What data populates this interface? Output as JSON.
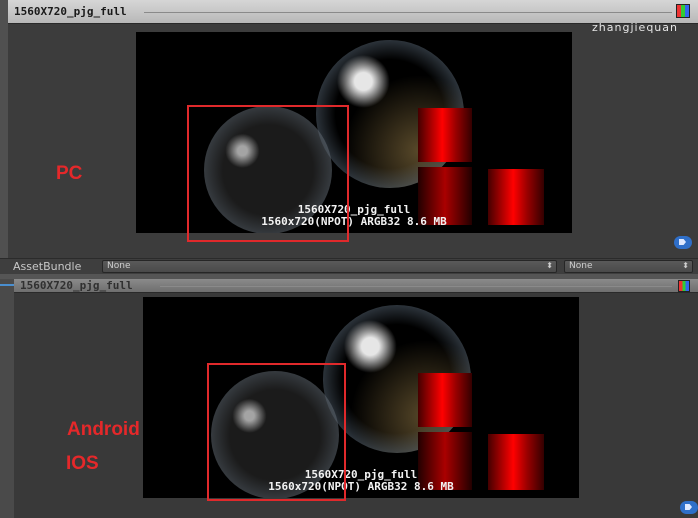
{
  "top_window": {
    "title": "1560X720_pjg_full",
    "watermark": "zhangjiequan",
    "preview_name": "1560X720_pjg_full",
    "preview_details": "1560x720(NPOT)  ARGB32  8.6 MB",
    "platform_label": "PC"
  },
  "asset_bundle": {
    "label": "AssetBundle",
    "name_value": "None",
    "variant_value": "None",
    "arrow": "⬍"
  },
  "bottom_window": {
    "title": "1560X720_pjg_full",
    "preview_name": "1560X720_pjg_full",
    "preview_details": "1560x720(NPOT)  ARGB32  8.6 MB",
    "platform_label_1": "Android",
    "platform_label_2": "IOS"
  },
  "colors": {
    "highlight_red": "#e0292b",
    "label_red": "#e5282a",
    "tag_blue": "#2f6fc9"
  },
  "icons": [
    "rgb-channels-icon",
    "tag-icon",
    "dropdown-arrow-icon"
  ]
}
